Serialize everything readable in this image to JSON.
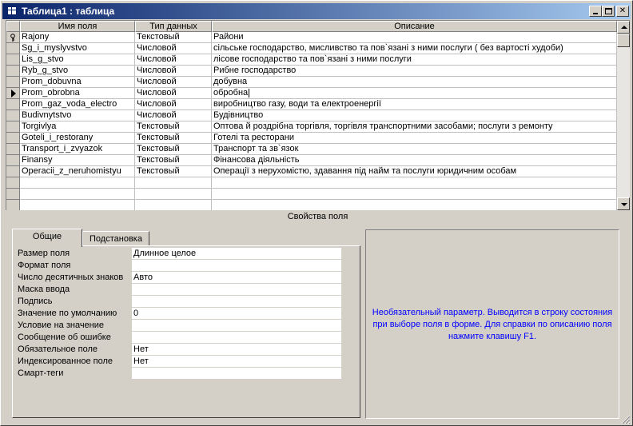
{
  "window": {
    "title": "Таблица1 : таблица"
  },
  "grid": {
    "columns": [
      "Имя поля",
      "Тип данных",
      "Описание"
    ],
    "rows": [
      {
        "name": "Rajony",
        "type": "Текстовый",
        "desc": "Райони",
        "key": true
      },
      {
        "name": "Sg_i_myslyvstvo",
        "type": "Числовой",
        "desc": "сільське господарство, мисливство та пов`язані з ними послуги ( без вартості худоби)"
      },
      {
        "name": "Lis_g_stvo",
        "type": "Числовой",
        "desc": "лісове господарство та пов`язані з ними послуги"
      },
      {
        "name": "Ryb_g_stvo",
        "type": "Числовой",
        "desc": "Рибне господарство"
      },
      {
        "name": "Prom_dobuvna",
        "type": "Числовой",
        "desc": "добувна"
      },
      {
        "name": "Prom_obrobna",
        "type": "Числовой",
        "desc": "обробна",
        "current": true
      },
      {
        "name": "Prom_gaz_voda_electro",
        "type": "Числовой",
        "desc": "виробництво газу, води та електроенергії"
      },
      {
        "name": "Budivnytstvo",
        "type": "Числовой",
        "desc": "Будівництво"
      },
      {
        "name": "Torgivlya",
        "type": "Текстовый",
        "desc": "Оптова й роздрібна торгівля, торгівля транспортними засобами; послуги з ремонту"
      },
      {
        "name": "Goteli_i_restorany",
        "type": "Текстовый",
        "desc": "Готелі та ресторани"
      },
      {
        "name": "Transport_i_zvyazok",
        "type": "Текстовый",
        "desc": "Транспорт та зв`язок"
      },
      {
        "name": "Finansy",
        "type": "Текстовый",
        "desc": "Фінансова діяльність"
      },
      {
        "name": "Operacii_z_neruhomistyu",
        "type": "Текстовый",
        "desc": "Операції з нерухомістю, здавання під найм та послуги юридичним особам"
      }
    ]
  },
  "properties": {
    "title": "Свойства поля",
    "tabs": [
      "Общие",
      "Подстановка"
    ],
    "items": [
      {
        "label": "Размер поля",
        "value": "Длинное целое"
      },
      {
        "label": "Формат поля",
        "value": ""
      },
      {
        "label": "Число десятичных знаков",
        "value": "Авто"
      },
      {
        "label": "Маска ввода",
        "value": ""
      },
      {
        "label": "Подпись",
        "value": ""
      },
      {
        "label": "Значение по умолчанию",
        "value": "0"
      },
      {
        "label": "Условие на значение",
        "value": ""
      },
      {
        "label": "Сообщение об ошибке",
        "value": ""
      },
      {
        "label": "Обязательное поле",
        "value": "Нет"
      },
      {
        "label": "Индексированное поле",
        "value": "Нет"
      },
      {
        "label": "Смарт-теги",
        "value": ""
      }
    ],
    "help": "Необязательный параметр.  Выводится в строку состояния при выборе поля в форме.  Для справки по описанию поля нажмите клавишу F1."
  },
  "colors": {
    "titlebar_start": "#0a246a",
    "titlebar_end": "#a6caf0",
    "face": "#d4d0c8",
    "help_text": "#0000ff"
  }
}
